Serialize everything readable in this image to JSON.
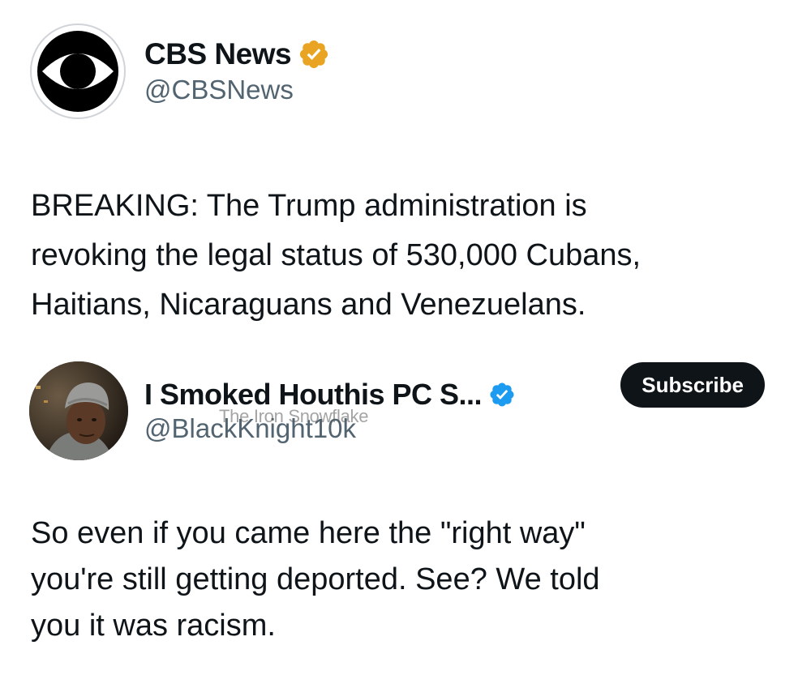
{
  "tweets": [
    {
      "author": {
        "name": "CBS News",
        "handle": "@CBSNews",
        "verified_type": "gold",
        "avatar_icon": "cbs-eye-logo-icon"
      },
      "text": "BREAKING: The Trump administration is\nrevoking the legal status of 530,000 Cubans,\nHaitians, Nicaraguans and Venezuelans."
    },
    {
      "author": {
        "name": "I Smoked Houthis PC S...",
        "handle": "@BlackKnight10k",
        "verified_type": "blue",
        "avatar_icon": "user-photo-avatar"
      },
      "subscribe_label": "Subscribe",
      "watermark": "The Iron Snowflake",
      "text": "So even if you came here the \"right way\"\nyou're still getting deported. See? We told\nyou it was racism."
    }
  ],
  "colors": {
    "gold_badge": "#E8A422",
    "blue_badge": "#1D9BF0",
    "button_bg": "#0F1419",
    "handle_gray": "#536471"
  }
}
